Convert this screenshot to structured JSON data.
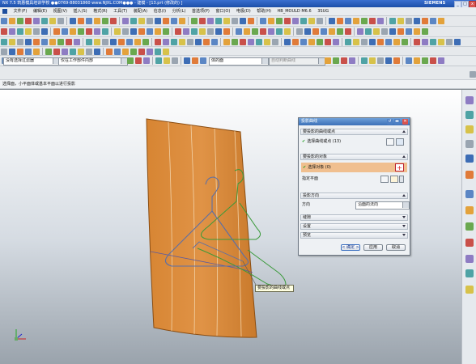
{
  "titlebar": {
    "text": "NX 7.5 筑惠模具培训学校 ●●0769-88031860 www.NJXL.COM●●● - 建模 - [13.prt (修改的) ]",
    "brand": "SIEMENS",
    "btn_min": "_",
    "btn_max": "□",
    "btn_close": "x"
  },
  "menu": {
    "items": [
      "文件(F)",
      "编辑(E)",
      "视图(V)",
      "插入(S)",
      "格式(R)",
      "工具(T)",
      "装配(A)",
      "信息(I)",
      "分析(L)",
      "首选项(P)",
      "窗口(O)",
      "电极(D)",
      "帮助(H)",
      "HB_MOULD M6.6",
      "3SUG"
    ]
  },
  "selbar": {
    "filter": "没有选择过滤器",
    "scope": "仅在工作部件内部",
    "snap": "体的面",
    "extra": "自动判断曲线"
  },
  "cueline": {
    "text": "选择面，小平面体或基本平面以进行投影"
  },
  "dialog": {
    "title": "投影曲线",
    "sec_curves": "要投影的曲线或点",
    "sel_curves": "选择曲线或点 (13)",
    "sec_objects": "要投影的对象",
    "sel_objects": "选择对象 (0)",
    "specify_plane": "指定平面",
    "sec_direction": "投影方向",
    "direction_label": "方向",
    "direction_value": "沿面的法向",
    "sec_gap": "缝隙",
    "sec_settings": "设置",
    "sec_preview": "预览",
    "ok": "< 确定 >",
    "apply": "应用",
    "cancel": "取消"
  },
  "tooltip": {
    "text": "要投影的曲线或点"
  },
  "colors": {
    "surface": "#d98a36",
    "surface_edge": "#8a4d12",
    "hanger": "#5a6fa8",
    "projected": "#3a9a3a",
    "highlight": "#e0812e"
  }
}
